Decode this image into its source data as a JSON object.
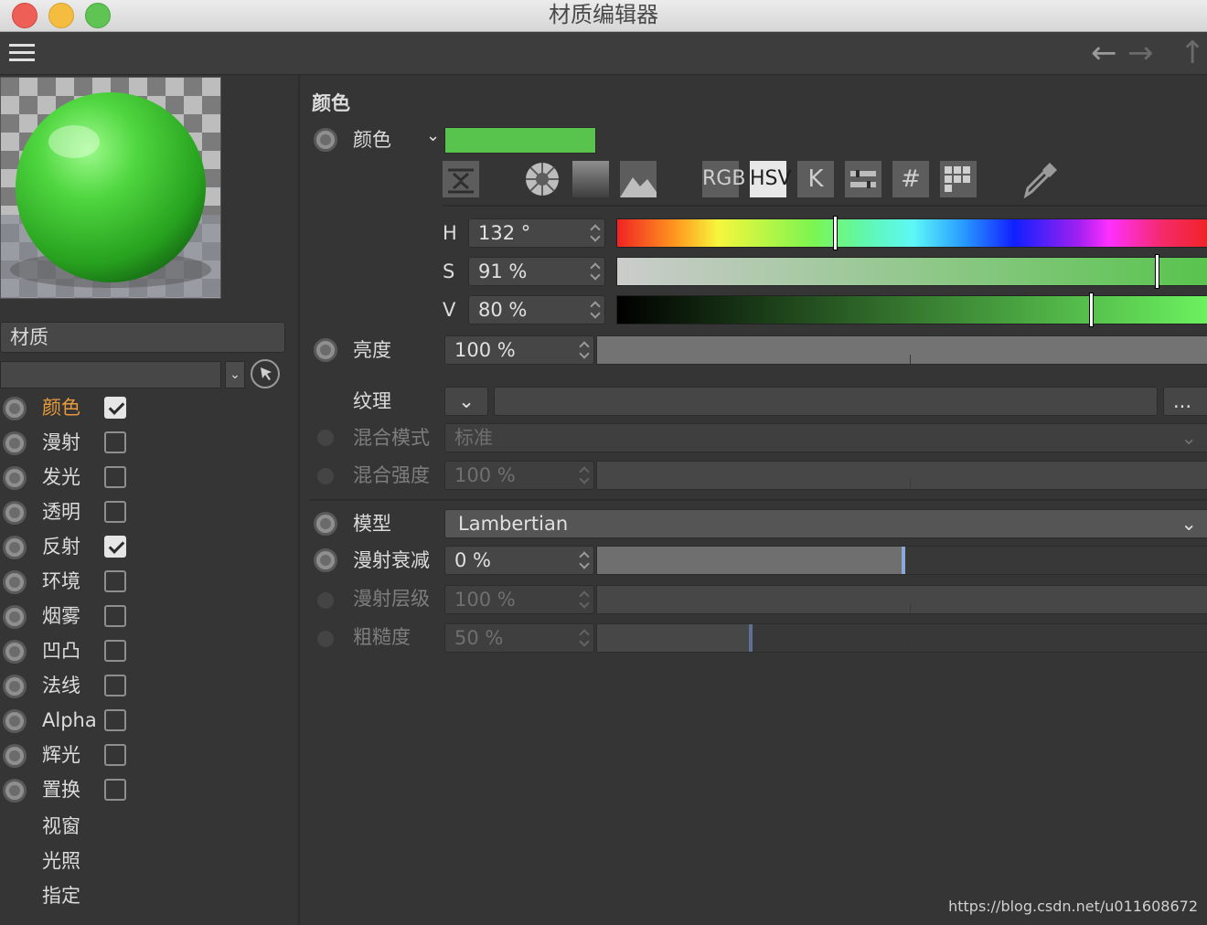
{
  "window": {
    "title": "材质编辑器"
  },
  "channels": {
    "material_name": "材质",
    "items": [
      {
        "label": "颜色",
        "checked": true,
        "active": true
      },
      {
        "label": "漫射",
        "checked": false
      },
      {
        "label": "发光",
        "checked": false
      },
      {
        "label": "透明",
        "checked": false
      },
      {
        "label": "反射",
        "checked": true
      },
      {
        "label": "环境",
        "checked": false
      },
      {
        "label": "烟雾",
        "checked": false
      },
      {
        "label": "凹凸",
        "checked": false
      },
      {
        "label": "法线",
        "checked": false
      },
      {
        "label": "Alpha",
        "checked": false
      },
      {
        "label": "辉光",
        "checked": false
      },
      {
        "label": "置换",
        "checked": false
      }
    ],
    "extra": [
      "视窗",
      "光照",
      "指定"
    ]
  },
  "color_section": {
    "heading": "颜色",
    "color_label": "颜色",
    "swatch_color": "#58c44d",
    "mode_buttons": {
      "rgb": "RGB",
      "hsv": "HSV",
      "k": "K",
      "hex": "#"
    },
    "h_label": "H",
    "h_value": "132 °",
    "s_label": "S",
    "s_value": "91 %",
    "v_label": "V",
    "v_value": "80 %",
    "h_fraction": 0.367,
    "s_fraction": 0.91,
    "v_fraction": 0.8
  },
  "brightness": {
    "label": "亮度",
    "value": "100 %"
  },
  "texture": {
    "label": "纹理",
    "more": "..."
  },
  "blend_mode": {
    "label": "混合模式",
    "value": "标准"
  },
  "blend_strength": {
    "label": "混合强度",
    "value": "100 %"
  },
  "model": {
    "label": "模型",
    "value": "Lambertian"
  },
  "diffuse_falloff": {
    "label": "漫射衰减",
    "value": "0 %",
    "fraction": 0.5
  },
  "diffuse_level": {
    "label": "漫射层级",
    "value": "100 %"
  },
  "roughness": {
    "label": "粗糙度",
    "value": "50 %",
    "fraction": 0.25
  },
  "watermark": "https://blog.csdn.net/u011608672",
  "colors": {
    "accent_orange": "#e89a3c",
    "green": "#58c44d",
    "blue_knob": "#8aa9d8"
  }
}
